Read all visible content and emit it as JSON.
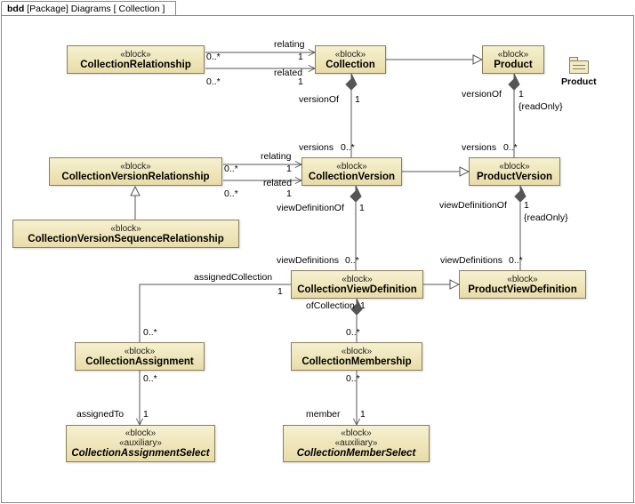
{
  "frame": {
    "kind": "bdd",
    "scope": "[Package] Diagrams",
    "name": "Collection"
  },
  "note_label": "Product",
  "blocks": {
    "collRel": {
      "stereo": "«block»",
      "name": "CollectionRelationship"
    },
    "collection": {
      "stereo": "«block»",
      "name": "Collection"
    },
    "product": {
      "stereo": "«block»",
      "name": "Product"
    },
    "collVerRel": {
      "stereo": "«block»",
      "name": "CollectionVersionRelationship"
    },
    "collVer": {
      "stereo": "«block»",
      "name": "CollectionVersion"
    },
    "prodVer": {
      "stereo": "«block»",
      "name": "ProductVersion"
    },
    "collVerSeq": {
      "stereo": "«block»",
      "name": "CollectionVersionSequenceRelationship"
    },
    "collViewDef": {
      "stereo": "«block»",
      "name": "CollectionViewDefinition"
    },
    "prodViewDef": {
      "stereo": "«block»",
      "name": "ProductViewDefinition"
    },
    "collAssign": {
      "stereo": "«block»",
      "name": "CollectionAssignment"
    },
    "collMember": {
      "stereo": "«block»",
      "name": "CollectionMembership"
    },
    "collAssignSel": {
      "stereo1": "«block»",
      "stereo2": "«auxiliary»",
      "name": "CollectionAssignmentSelect"
    },
    "collMemberSel": {
      "stereo1": "«block»",
      "stereo2": "«auxiliary»",
      "name": "CollectionMemberSelect"
    }
  },
  "labels": {
    "relating": "relating",
    "related": "related",
    "one": "1",
    "zeroStar": "0..*",
    "versionOf": "versionOf",
    "versions": "versions",
    "readOnly": "{readOnly}",
    "viewDefinitionOf": "viewDefinitionOf",
    "viewDefinitions": "viewDefinitions",
    "assignedCollection": "assignedCollection",
    "ofCollection": "ofCollection",
    "assignedTo": "assignedTo",
    "member": "member"
  },
  "chart_data": {
    "type": "table",
    "diagram_kind": "SysML Block Definition Diagram",
    "frame": "bdd [Package] Diagrams [ Collection ]",
    "blocks": [
      {
        "name": "CollectionRelationship",
        "stereotypes": [
          "block"
        ]
      },
      {
        "name": "Collection",
        "stereotypes": [
          "block"
        ]
      },
      {
        "name": "Product",
        "stereotypes": [
          "block"
        ]
      },
      {
        "name": "CollectionVersionRelationship",
        "stereotypes": [
          "block"
        ]
      },
      {
        "name": "CollectionVersion",
        "stereotypes": [
          "block"
        ]
      },
      {
        "name": "ProductVersion",
        "stereotypes": [
          "block"
        ]
      },
      {
        "name": "CollectionVersionSequenceRelationship",
        "stereotypes": [
          "block"
        ]
      },
      {
        "name": "CollectionViewDefinition",
        "stereotypes": [
          "block"
        ]
      },
      {
        "name": "ProductViewDefinition",
        "stereotypes": [
          "block"
        ]
      },
      {
        "name": "CollectionAssignment",
        "stereotypes": [
          "block"
        ]
      },
      {
        "name": "CollectionMembership",
        "stereotypes": [
          "block"
        ]
      },
      {
        "name": "CollectionAssignmentSelect",
        "stereotypes": [
          "block",
          "auxiliary"
        ],
        "abstract": true
      },
      {
        "name": "CollectionMemberSelect",
        "stereotypes": [
          "block",
          "auxiliary"
        ],
        "abstract": true
      }
    ],
    "generalizations": [
      {
        "sub": "Collection",
        "super": "Product"
      },
      {
        "sub": "CollectionVersion",
        "super": "ProductVersion"
      },
      {
        "sub": "CollectionViewDefinition",
        "super": "ProductViewDefinition"
      },
      {
        "sub": "CollectionVersionSequenceRelationship",
        "super": "CollectionVersionRelationship"
      }
    ],
    "associations": [
      {
        "end1": {
          "type": "CollectionRelationship",
          "mult": "0..*"
        },
        "end2": {
          "type": "Collection",
          "role": "relating",
          "mult": "1"
        }
      },
      {
        "end1": {
          "type": "CollectionRelationship",
          "mult": "0..*"
        },
        "end2": {
          "type": "Collection",
          "role": "related",
          "mult": "1"
        }
      },
      {
        "end1": {
          "type": "CollectionVersionRelationship",
          "mult": "0..*"
        },
        "end2": {
          "type": "CollectionVersion",
          "role": "relating",
          "mult": "1"
        }
      },
      {
        "end1": {
          "type": "CollectionVersionRelationship",
          "mult": "0..*"
        },
        "end2": {
          "type": "CollectionVersion",
          "role": "related",
          "mult": "1"
        }
      },
      {
        "end1": {
          "type": "Collection",
          "role": "versionOf",
          "mult": "1",
          "aggregation": "composite"
        },
        "end2": {
          "type": "CollectionVersion",
          "role": "versions",
          "mult": "0..*"
        }
      },
      {
        "end1": {
          "type": "Product",
          "role": "versionOf",
          "mult": "1",
          "constraint": "readOnly",
          "aggregation": "composite"
        },
        "end2": {
          "type": "ProductVersion",
          "role": "versions",
          "mult": "0..*"
        }
      },
      {
        "end1": {
          "type": "CollectionVersion",
          "role": "viewDefinitionOf",
          "mult": "1",
          "aggregation": "composite"
        },
        "end2": {
          "type": "CollectionViewDefinition",
          "role": "viewDefinitions",
          "mult": "0..*"
        }
      },
      {
        "end1": {
          "type": "ProductVersion",
          "role": "viewDefinitionOf",
          "mult": "1",
          "constraint": "readOnly",
          "aggregation": "composite"
        },
        "end2": {
          "type": "ProductViewDefinition",
          "role": "viewDefinitions",
          "mult": "0..*"
        }
      },
      {
        "end1": {
          "type": "CollectionViewDefinition",
          "role": "assignedCollection",
          "mult": "1"
        },
        "end2": {
          "type": "CollectionAssignment",
          "mult": "0..*"
        }
      },
      {
        "end1": {
          "type": "CollectionViewDefinition",
          "role": "ofCollection",
          "mult": "1",
          "aggregation": "composite"
        },
        "end2": {
          "type": "CollectionMembership",
          "mult": "0..*"
        }
      },
      {
        "end1": {
          "type": "CollectionAssignment",
          "mult": "0..*"
        },
        "end2": {
          "type": "CollectionAssignmentSelect",
          "role": "assignedTo",
          "mult": "1"
        }
      },
      {
        "end1": {
          "type": "CollectionMembership",
          "mult": "0..*"
        },
        "end2": {
          "type": "CollectionMemberSelect",
          "role": "member",
          "mult": "1"
        }
      }
    ]
  }
}
